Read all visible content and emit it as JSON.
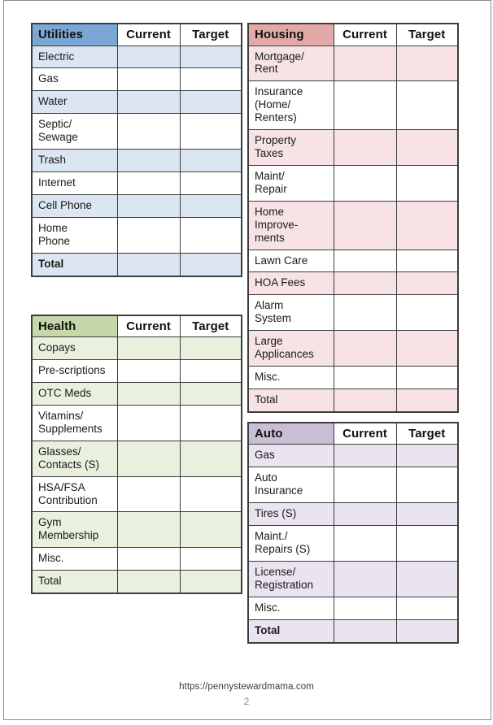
{
  "document": {
    "page_number": "2",
    "footer_url": "https://pennystewardmama.com"
  },
  "columns": {
    "current": "Current",
    "target": "Target"
  },
  "colors": {
    "utilities_header": "#7BA7D7",
    "utilities_row": "#DCE6F2",
    "health_header": "#C6D7A8",
    "health_row": "#EAF0DE",
    "housing_header": "#E3A9A9",
    "housing_row": "#F7E3E3",
    "auto_header": "#C9BFD5",
    "auto_row": "#E9E4EF",
    "border": "#3D3D3D",
    "page_border": "#8D8D8D"
  },
  "tables": [
    {
      "id": "utilities",
      "title": "Utilities",
      "header_color": "#7BA7D7",
      "row_color": "#DCE6F2",
      "rows": [
        {
          "label": "Electric",
          "current": "",
          "target": "",
          "bold": false
        },
        {
          "label": "Gas",
          "current": "",
          "target": "",
          "bold": false
        },
        {
          "label": "Water",
          "current": "",
          "target": "",
          "bold": false
        },
        {
          "label": "Septic/\nSewage",
          "current": "",
          "target": "",
          "bold": false
        },
        {
          "label": "Trash",
          "current": "",
          "target": "",
          "bold": false
        },
        {
          "label": "Internet",
          "current": "",
          "target": "",
          "bold": false
        },
        {
          "label": "Cell Phone",
          "current": "",
          "target": "",
          "bold": false
        },
        {
          "label": "Home\nPhone",
          "current": "",
          "target": "",
          "bold": false
        },
        {
          "label": "Total",
          "current": "",
          "target": "",
          "bold": true
        }
      ]
    },
    {
      "id": "health",
      "title": "Health",
      "header_color": "#C6D7A8",
      "row_color": "#EAF0DE",
      "rows": [
        {
          "label": "Copays",
          "current": "",
          "target": "",
          "bold": false
        },
        {
          "label": "Pre-scriptions",
          "current": "",
          "target": "",
          "bold": false
        },
        {
          "label": "OTC Meds",
          "current": "",
          "target": "",
          "bold": false
        },
        {
          "label": "Vitamins/\nSupplements",
          "current": "",
          "target": "",
          "bold": false
        },
        {
          "label": "Glasses/\nContacts (S)",
          "current": "",
          "target": "",
          "bold": false
        },
        {
          "label": "HSA/FSA\nContribution",
          "current": "",
          "target": "",
          "bold": false
        },
        {
          "label": "Gym\nMembership",
          "current": "",
          "target": "",
          "bold": false
        },
        {
          "label": "Misc.",
          "current": "",
          "target": "",
          "bold": false
        },
        {
          "label": "Total",
          "current": "",
          "target": "",
          "bold": false
        }
      ]
    },
    {
      "id": "housing",
      "title": "Housing",
      "header_color": "#E3A9A9",
      "row_color": "#F7E3E3",
      "rows": [
        {
          "label": "Mortgage/\nRent",
          "current": "",
          "target": "",
          "bold": false
        },
        {
          "label": "Insurance\n(Home/\nRenters)",
          "current": "",
          "target": "",
          "bold": false
        },
        {
          "label": "Property\nTaxes",
          "current": "",
          "target": "",
          "bold": false
        },
        {
          "label": "Maint/\nRepair",
          "current": "",
          "target": "",
          "bold": false
        },
        {
          "label": "Home\nImprove-\nments",
          "current": "",
          "target": "",
          "bold": false
        },
        {
          "label": "Lawn Care",
          "current": "",
          "target": "",
          "bold": false
        },
        {
          "label": "HOA Fees",
          "current": "",
          "target": "",
          "bold": false
        },
        {
          "label": "Alarm\nSystem",
          "current": "",
          "target": "",
          "bold": false
        },
        {
          "label": "Large\nApplicances",
          "current": "",
          "target": "",
          "bold": false
        },
        {
          "label": "Misc.",
          "current": "",
          "target": "",
          "bold": false
        },
        {
          "label": "Total",
          "current": "",
          "target": "",
          "bold": false
        }
      ]
    },
    {
      "id": "auto",
      "title": "Auto",
      "header_color": "#C9BFD5",
      "row_color": "#E9E4EF",
      "rows": [
        {
          "label": "Gas",
          "current": "",
          "target": "",
          "bold": false
        },
        {
          "label": "Auto\nInsurance",
          "current": "",
          "target": "",
          "bold": false
        },
        {
          "label": "Tires (S)",
          "current": "",
          "target": "",
          "bold": false
        },
        {
          "label": "Maint./\nRepairs (S)",
          "current": "",
          "target": "",
          "bold": false
        },
        {
          "label": "License/\nRegistration",
          "current": "",
          "target": "",
          "bold": false
        },
        {
          "label": "Misc.",
          "current": "",
          "target": "",
          "bold": false
        },
        {
          "label": "Total",
          "current": "",
          "target": "",
          "bold": true
        }
      ]
    }
  ]
}
